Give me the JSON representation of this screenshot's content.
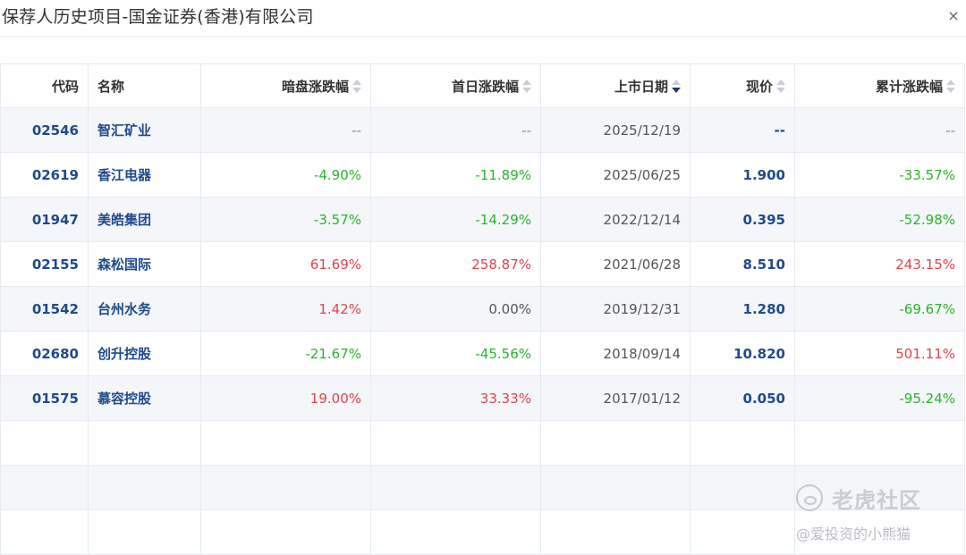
{
  "dialog": {
    "title": "保荐人历史项目-国金证券(香港)有限公司",
    "close_glyph": "×"
  },
  "table": {
    "columns": [
      {
        "key": "code",
        "label": "代码",
        "sortable": false
      },
      {
        "key": "name",
        "label": "名称",
        "sortable": false
      },
      {
        "key": "grey",
        "label": "暗盘涨跌幅",
        "sortable": true,
        "active": false
      },
      {
        "key": "first",
        "label": "首日涨跌幅",
        "sortable": true,
        "active": false
      },
      {
        "key": "date",
        "label": "上市日期",
        "sortable": true,
        "active": true,
        "direction": "desc"
      },
      {
        "key": "price",
        "label": "现价",
        "sortable": true,
        "active": false
      },
      {
        "key": "cum",
        "label": "累计涨跌幅",
        "sortable": true,
        "active": false
      }
    ],
    "rows": [
      {
        "code": "02546",
        "name": "智汇矿业",
        "grey": "--",
        "first": "--",
        "date": "2025/12/19",
        "price": "--",
        "cum": "--"
      },
      {
        "code": "02619",
        "name": "香江电器",
        "grey": "-4.90%",
        "first": "-11.89%",
        "date": "2025/06/25",
        "price": "1.900",
        "cum": "-33.57%"
      },
      {
        "code": "01947",
        "name": "美皓集团",
        "grey": "-3.57%",
        "first": "-14.29%",
        "date": "2022/12/14",
        "price": "0.395",
        "cum": "-52.98%"
      },
      {
        "code": "02155",
        "name": "森松国际",
        "grey": "61.69%",
        "first": "258.87%",
        "date": "2021/06/28",
        "price": "8.510",
        "cum": "243.15%"
      },
      {
        "code": "01542",
        "name": "台州水务",
        "grey": "1.42%",
        "first": "0.00%",
        "date": "2019/12/31",
        "price": "1.280",
        "cum": "-69.67%"
      },
      {
        "code": "02680",
        "name": "创升控股",
        "grey": "-21.67%",
        "first": "-45.56%",
        "date": "2018/09/14",
        "price": "10.820",
        "cum": "501.11%"
      },
      {
        "code": "01575",
        "name": "慕容控股",
        "grey": "19.00%",
        "first": "33.33%",
        "date": "2017/01/12",
        "price": "0.050",
        "cum": "-95.24%"
      }
    ],
    "empty_rows": 3
  },
  "colors": {
    "up": "#e0424b",
    "down": "#2bb32b",
    "link": "#1f4a8c",
    "alt_row": "#f4f6fa"
  },
  "watermark": {
    "brand": "老虎社区",
    "user": "@爱投资的小熊猫",
    "logo_icon": "tiger-logo-icon"
  }
}
